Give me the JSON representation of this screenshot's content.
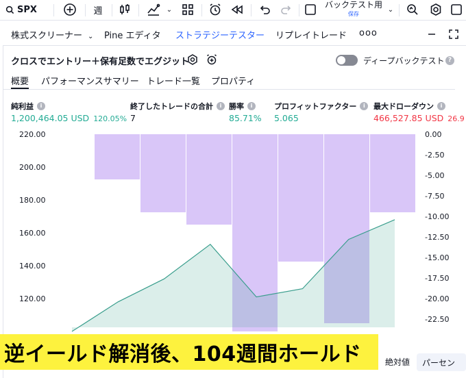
{
  "toolbar": {
    "symbol": "SPX",
    "interval": "週",
    "layout_name": "バックテスト用",
    "layout_status": "保存"
  },
  "panel_tabs": [
    {
      "label": "株式スクリーナー",
      "active": false,
      "has_dropdown": true
    },
    {
      "label": "Pine エディタ",
      "active": false,
      "has_dropdown": false
    },
    {
      "label": "ストラテジーテスター",
      "active": true,
      "has_dropdown": false
    },
    {
      "label": "リプレイトレード",
      "active": false,
      "has_dropdown": false
    },
    {
      "label": "ooo",
      "active": false,
      "has_dropdown": false
    }
  ],
  "strategy": {
    "name": "クロスでエントリー＋保有足数でエグジット",
    "deep_backtest_label": "ディープバックテスト",
    "deep_backtest_enabled": false
  },
  "subtabs": [
    {
      "label": "概要",
      "active": true
    },
    {
      "label": "パフォーマンスサマリー",
      "active": false
    },
    {
      "label": "トレード一覧",
      "active": false
    },
    {
      "label": "プロパティ",
      "active": false
    }
  ],
  "metrics": {
    "net_profit": {
      "label": "純利益",
      "value": "1,200,464.05 USD",
      "sub": "120.05%"
    },
    "closed_trades": {
      "label": "終了したトレードの合計",
      "value": "7"
    },
    "win_rate": {
      "label": "勝率",
      "value": "85.71%"
    },
    "profit_factor": {
      "label": "プロフィットファクター",
      "value": "5.065"
    },
    "max_drawdown": {
      "label": "最大ドローダウン",
      "value": "466,527.85 USD",
      "sub": "26.9"
    }
  },
  "colors": {
    "accent": "#2962ff",
    "positive": "#22ab94",
    "negative": "#f23645",
    "equity_line": "#3a9e8d",
    "drawdown_bar": "#d7c3f8",
    "caption_bg": "#fdf23e"
  },
  "chart_data": {
    "type": "line",
    "left_axis": {
      "ticks": [
        "220.00",
        "200.00",
        "180.00",
        "160.00",
        "140.00",
        "120.00"
      ],
      "range": [
        100,
        220
      ]
    },
    "right_axis": {
      "ticks": [
        "0.00",
        "-2.50",
        "-5.00",
        "-7.50",
        "-10.00",
        "-12.50",
        "-15.00",
        "-17.50",
        "-20.00",
        "-22.50"
      ],
      "range": [
        -24.5,
        0
      ]
    },
    "equity_points": [
      100,
      118,
      132,
      153,
      121,
      126,
      156,
      168
    ],
    "drawdown_bars": [
      -5.5,
      -9.5,
      -11.0,
      -24.0,
      -15.5,
      -23.0,
      -9.5
    ]
  },
  "caption": "逆イールド解消後、104週間ホールド",
  "bottom_buttons": {
    "absolute": "絶対値",
    "percent": "パーセン"
  }
}
